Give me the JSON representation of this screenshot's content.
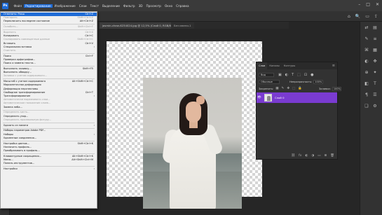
{
  "menubar": {
    "logo": "Ps",
    "items": [
      "Файл",
      "Редактирование",
      "Изображение",
      "Слои",
      "Текст",
      "Выделение",
      "Фильтр",
      "3D",
      "Просмотр",
      "Окно",
      "Справка"
    ],
    "active_index": 1,
    "window_controls": [
      "–",
      "□",
      "✕"
    ]
  },
  "optbar": {
    "icons": [
      "⌂",
      "🔍",
      "▭",
      "⇪"
    ]
  },
  "tabs": [
    {
      "label": "jasmin-chew-6234024.jpg @ 12,5% (Слой 0, RGB/8*) *"
    },
    {
      "label": "Без имени-1"
    }
  ],
  "tools": [
    "move-icon",
    "marquee-icon",
    "lasso-icon",
    "quick-select-icon",
    "crop-icon",
    "frame-icon",
    "eyedropper-icon",
    "healing-icon",
    "brush-icon",
    "stamp-icon",
    "history-brush-icon",
    "eraser-icon",
    "gradient-icon",
    "blur-icon",
    "dodge-icon",
    "pen-icon",
    "type-icon",
    "path-select-icon",
    "shape-icon",
    "hand-icon",
    "zoom-icon",
    "more-icon"
  ],
  "tool_glyphs": [
    "✥",
    "⬚",
    "ʘ",
    "✎",
    "⌗",
    "⊠",
    "✒",
    "✚",
    "✏",
    "⎈",
    "↺",
    "⌫",
    "▦",
    "◉",
    "◐",
    "✑",
    "T",
    "➤",
    "▭",
    "✋",
    "🔍",
    "…"
  ],
  "active_tool_index": 20,
  "edit_menu": [
    {
      "label": "Отменить: Ракш",
      "shortcut": "Ctrl+Z",
      "state": "highlighted"
    },
    {
      "label": "Повторить",
      "shortcut": "Shift+Ctrl+Z",
      "state": "disabled"
    },
    {
      "label": "Переключить последнее состояние",
      "shortcut": "Alt+Ctrl+Z",
      "state": "normal"
    },
    {
      "sep": true
    },
    {
      "label": "Ослабить...",
      "shortcut": "Shift+Ctrl+F",
      "state": "disabled"
    },
    {
      "sep": true
    },
    {
      "label": "Вырезать",
      "shortcut": "Ctrl+X",
      "state": "disabled"
    },
    {
      "label": "Копировать",
      "shortcut": "Ctrl+C",
      "state": "normal"
    },
    {
      "label": "Скопировать совмещенные данные",
      "shortcut": "Shift+Ctrl+C",
      "state": "disabled"
    },
    {
      "label": "Вставить",
      "shortcut": "Ctrl+V",
      "state": "normal"
    },
    {
      "label": "Специальная вставка",
      "shortcut": "",
      "state": "normal",
      "submenu": true
    },
    {
      "label": "Очистить",
      "shortcut": "",
      "state": "disabled"
    },
    {
      "sep": true
    },
    {
      "label": "Поиск",
      "shortcut": "Ctrl+F",
      "state": "normal"
    },
    {
      "label": "Проверка орфографии...",
      "shortcut": "",
      "state": "normal"
    },
    {
      "label": "Поиск и замена текста...",
      "shortcut": "",
      "state": "normal"
    },
    {
      "sep": true
    },
    {
      "label": "Выполнить заливку...",
      "shortcut": "Shift+F5",
      "state": "normal"
    },
    {
      "label": "Выполнить обводку...",
      "shortcut": "",
      "state": "normal"
    },
    {
      "label": "Заливка с учетом содержимого...",
      "shortcut": "",
      "state": "disabled"
    },
    {
      "sep": true
    },
    {
      "label": "Масштаб с учетом содержимого",
      "shortcut": "Alt+Shift+Ctrl+C",
      "state": "normal"
    },
    {
      "label": "Марионеточная деформация",
      "shortcut": "",
      "state": "normal"
    },
    {
      "label": "Деформация перспективы",
      "shortcut": "",
      "state": "normal"
    },
    {
      "label": "Свободное трансформирование",
      "shortcut": "Ctrl+T",
      "state": "normal"
    },
    {
      "label": "Трансформирование",
      "shortcut": "",
      "state": "normal",
      "submenu": true
    },
    {
      "label": "Автоматически выравнивать слои...",
      "shortcut": "",
      "state": "disabled"
    },
    {
      "label": "Автоматическое наложение слоев...",
      "shortcut": "",
      "state": "disabled"
    },
    {
      "label": "Замена неба...",
      "shortcut": "",
      "state": "normal"
    },
    {
      "sep": true
    },
    {
      "label": "Определить кисть...",
      "shortcut": "",
      "state": "disabled"
    },
    {
      "label": "Определить узор...",
      "shortcut": "",
      "state": "normal"
    },
    {
      "label": "Определить произвольную фигуру...",
      "shortcut": "",
      "state": "disabled"
    },
    {
      "sep": true
    },
    {
      "label": "Удалить из памяти",
      "shortcut": "",
      "state": "normal",
      "submenu": true
    },
    {
      "sep": true
    },
    {
      "label": "Наборы параметров Adobe PDF...",
      "shortcut": "",
      "state": "normal"
    },
    {
      "label": "Наборы",
      "shortcut": "",
      "state": "normal",
      "submenu": true
    },
    {
      "label": "Удаленные соединения...",
      "shortcut": "",
      "state": "normal"
    },
    {
      "sep": true
    },
    {
      "label": "Настройка цветов...",
      "shortcut": "Shift+Ctrl+K",
      "state": "normal"
    },
    {
      "label": "Назначить профиль...",
      "shortcut": "",
      "state": "normal"
    },
    {
      "label": "Преобразовать в профиль...",
      "shortcut": "",
      "state": "normal"
    },
    {
      "sep": true
    },
    {
      "label": "Клавиатурные сокращения...",
      "shortcut": "Alt+Shift+Ctrl+K",
      "state": "normal"
    },
    {
      "label": "Меню...",
      "shortcut": "Alt+Shift+Ctrl+M",
      "state": "normal"
    },
    {
      "label": "Панель инструментов...",
      "shortcut": "",
      "state": "normal"
    },
    {
      "sep": true
    },
    {
      "label": "Настройки",
      "shortcut": "",
      "state": "normal",
      "submenu": true
    }
  ],
  "layers_panel": {
    "tabs": [
      "Слои",
      "Каналы",
      "Контуры"
    ],
    "active_tab": 0,
    "menu_glyph": "≡",
    "filter_label": "Вид",
    "filter_icons": [
      "▣",
      "◐",
      "T",
      "⬚",
      "⊡",
      "●"
    ],
    "blend_mode": "Обычные",
    "opacity_label": "Непрозрачность:",
    "opacity_value": "100%",
    "lock_label": "Закрепить:",
    "lock_icons": [
      "▦",
      "✎",
      "✥",
      "⬚",
      "🔒"
    ],
    "fill_label": "Заливка:",
    "fill_value": "100%",
    "layer": {
      "name": "Слой 0",
      "visible_glyph": "👁"
    },
    "footer_icons": [
      "⛓",
      "fx",
      "◐",
      "◑",
      "▭",
      "⊞",
      "🗑"
    ]
  },
  "right_icons": [
    "⇄",
    "▤",
    "✎",
    "≡",
    "⌘",
    "▦",
    "◐",
    "✥",
    "⊕",
    "✦",
    "◧",
    "T",
    "¶",
    "☰",
    "❑",
    "⚙"
  ],
  "colors": {
    "accent": "#1e6bd6",
    "layer_selected": "#7a3bd1",
    "menu_bg": "#f0f0f0"
  }
}
